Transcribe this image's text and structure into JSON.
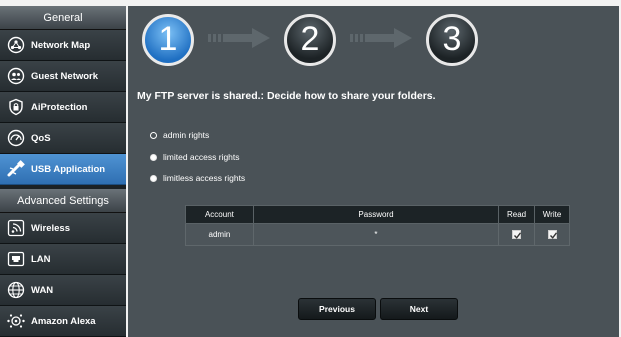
{
  "sidebar": {
    "general_header": "General",
    "advanced_header": "Advanced Settings",
    "items": [
      {
        "label": "Network Map",
        "icon": "network-map-icon"
      },
      {
        "label": "Guest Network",
        "icon": "guest-network-icon"
      },
      {
        "label": "AiProtection",
        "icon": "lock-icon"
      },
      {
        "label": "QoS",
        "icon": "speedometer-icon"
      },
      {
        "label": "USB Application",
        "icon": "usb-icon"
      }
    ],
    "advanced_items": [
      {
        "label": "Wireless",
        "icon": "wireless-icon"
      },
      {
        "label": "LAN",
        "icon": "lan-icon"
      },
      {
        "label": "WAN",
        "icon": "globe-icon"
      },
      {
        "label": "Amazon Alexa",
        "icon": "alexa-icon"
      }
    ],
    "active_item": "USB Application"
  },
  "steps": {
    "items": [
      "1",
      "2",
      "3"
    ],
    "current": "1"
  },
  "page": {
    "title": "My FTP server is shared.: Decide how to share your folders.",
    "options": [
      {
        "label": "admin rights",
        "selected": true
      },
      {
        "label": "limited access rights",
        "selected": false
      },
      {
        "label": "limitless access rights",
        "selected": false
      }
    ]
  },
  "table": {
    "headers": [
      "Account",
      "Password",
      "Read",
      "Write"
    ],
    "rows": [
      {
        "account": "admin",
        "password": "*",
        "read": true,
        "write": true
      }
    ]
  },
  "buttons": {
    "previous": "Previous",
    "next": "Next"
  },
  "colors": {
    "active_menu": "#3b82c4",
    "panel_bg": "#4a5257",
    "sidebar_bg": "#1b2125"
  }
}
